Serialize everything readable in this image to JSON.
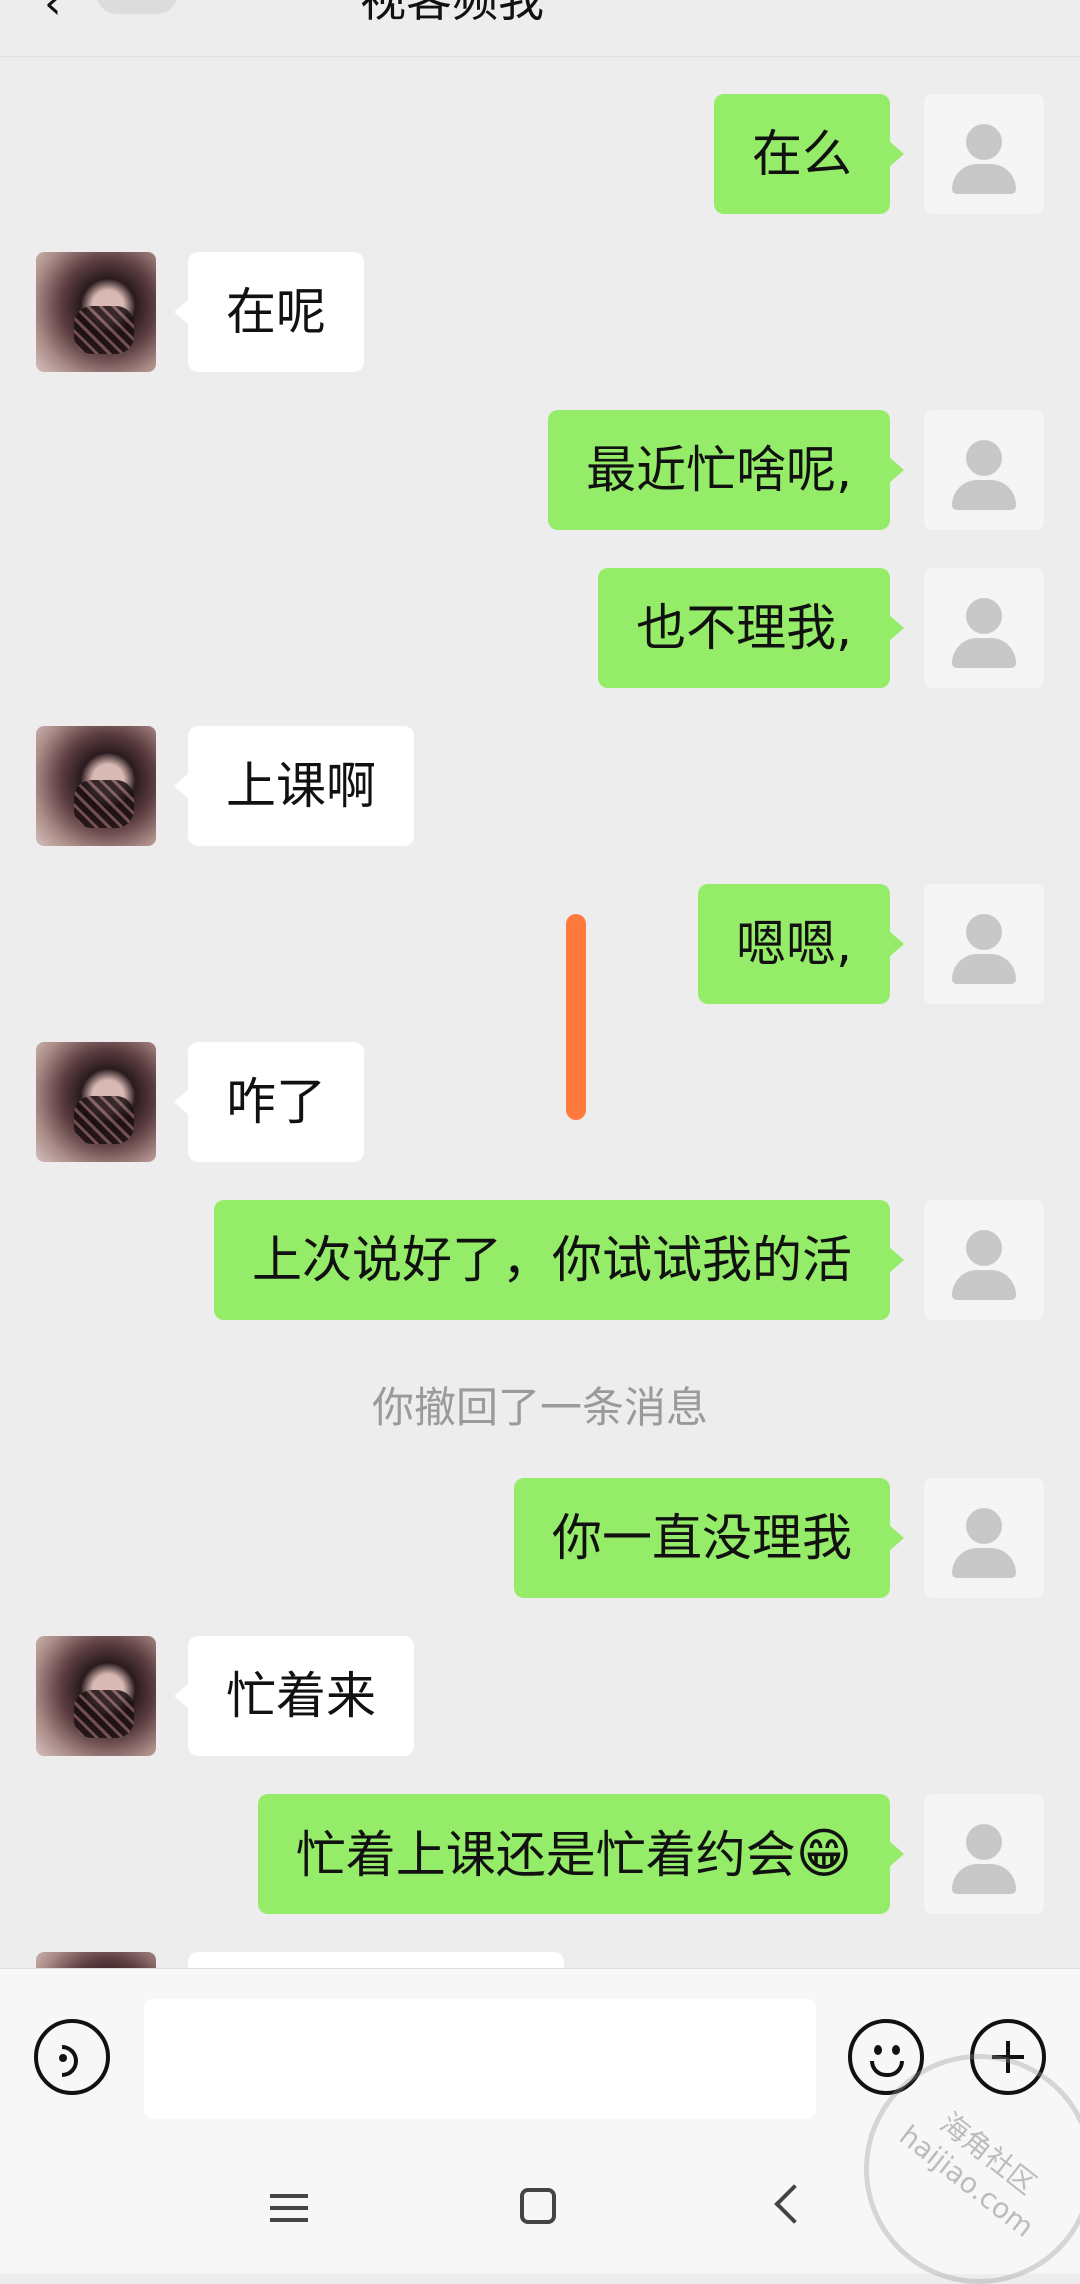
{
  "header": {
    "back_icon": "chevron-left-icon",
    "title": "视客频我"
  },
  "messages": [
    {
      "from": "self",
      "text": "在么"
    },
    {
      "from": "other",
      "text": "在呢"
    },
    {
      "from": "self",
      "text": "最近忙啥呢,"
    },
    {
      "from": "self",
      "text": "也不理我,"
    },
    {
      "from": "other",
      "text": "上课啊"
    },
    {
      "from": "self",
      "text": "嗯嗯,"
    },
    {
      "from": "other",
      "text": "咋了"
    },
    {
      "from": "self",
      "text": "上次说好了，你试试我的活"
    },
    {
      "from": "system",
      "text": "你撤回了一条消息"
    },
    {
      "from": "self",
      "text": "你一直没理我"
    },
    {
      "from": "other",
      "text": "忙着来"
    },
    {
      "from": "self",
      "text": "忙着上课还是忙着约会",
      "emoji": "😁"
    }
  ],
  "input": {
    "placeholder": "",
    "voice_icon": "voice-icon",
    "emoji_icon": "emoji-icon",
    "plus_icon": "plus-icon"
  },
  "nav": {
    "menu_icon": "menu-icon",
    "home_icon": "home-icon",
    "back_icon": "back-icon"
  },
  "watermark": {
    "text": "海角社区 haijiao.com"
  },
  "colors": {
    "self_bubble": "#95ec69",
    "other_bubble": "#ffffff",
    "background": "#ededed",
    "annotation_mark": "#ff7a3c"
  }
}
